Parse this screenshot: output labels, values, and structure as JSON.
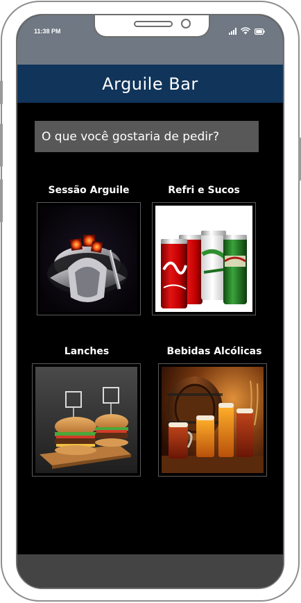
{
  "status_bar": {
    "time": "11:38 PM"
  },
  "app_bar": {
    "title": "Arguile Bar"
  },
  "prompt": {
    "text": "O que você gostaria de pedir?"
  },
  "categories": [
    {
      "label": "Sessão Arguile",
      "image": "hookah-photo"
    },
    {
      "label": "Refri e Sucos",
      "image": "soda-cans-photo"
    },
    {
      "label": "Lanches",
      "image": "burgers-photo"
    },
    {
      "label": "Bebidas Alcólicas",
      "image": "beer-barrel-photo"
    }
  ],
  "colors": {
    "app_bar": "#10345a",
    "status_bar": "#6f7883",
    "background": "#000000",
    "prompt_box": "#585858",
    "bottom_bar": "#444444"
  }
}
